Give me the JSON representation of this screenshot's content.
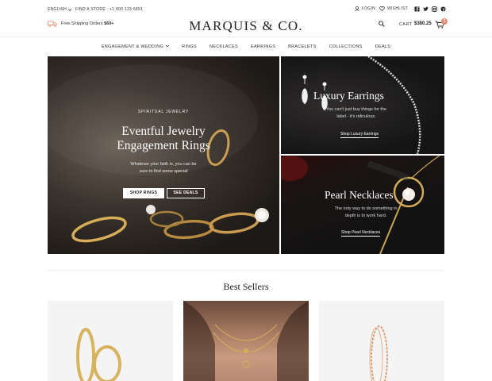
{
  "topbar": {
    "language": "ENGLISH",
    "find_store": "FIND A STORE",
    "phone": "+1 800 123 6891",
    "login": "LOGIN",
    "wishlist": "WISHLIST",
    "social_icons": [
      "facebook-icon",
      "twitter-icon",
      "instagram-icon",
      "pinterest-icon"
    ]
  },
  "header": {
    "shipping_text": "Free Shipping Orders ",
    "shipping_amount": "$60+",
    "logo": "MARQUIS & CO.",
    "cart_label": "CART",
    "cart_total": "$380.25",
    "cart_count": "2"
  },
  "nav": {
    "items": [
      "ENGAGEMENT & WEDDING",
      "RINGS",
      "NECKLACES",
      "EARRINGS",
      "BRACELETS",
      "COLLECTIONS",
      "DEALS"
    ]
  },
  "hero": {
    "eyebrow": "SPIRITUAL JEWELRY",
    "title_line1": "Eventful Jewelry",
    "title_line2": "Engagement Rings",
    "sub_line1": "Whatever your faith is, you can be",
    "sub_line2": "sure to find some special",
    "btn_shop": "SHOP RINGS",
    "btn_deals": "SEE DEALS"
  },
  "promo_earrings": {
    "title": "Luxury Earrings",
    "desc_line1": "You can't just buy things for the",
    "desc_line2": "label - it's ridiculous.",
    "link": "Shop Luxury Earrings"
  },
  "promo_necklaces": {
    "title": "Pearl Necklaces",
    "desc_line1": "The only way to do something in",
    "desc_line2": "depth is to work hard.",
    "link": "Shop Pearl Necklaces"
  },
  "best_sellers": {
    "title": "Best Sellers"
  },
  "colors": {
    "accent": "#e88d73",
    "gold": "#d4a857",
    "dark": "#1d1916"
  }
}
